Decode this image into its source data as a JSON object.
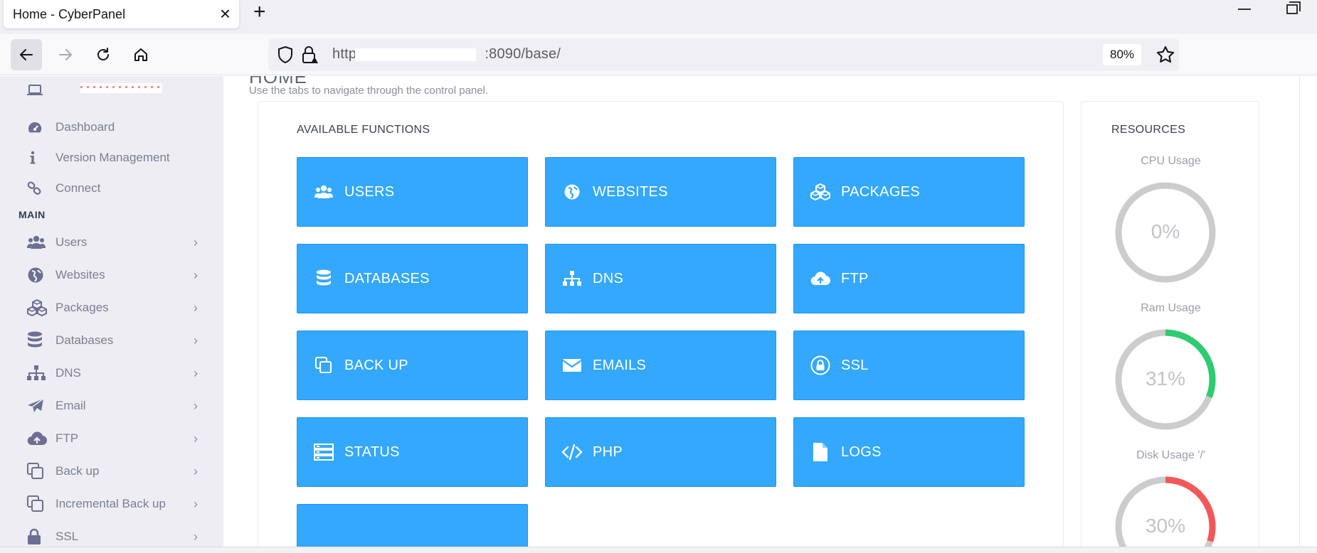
{
  "browser": {
    "tab_title": "Home - CyberPanel",
    "url_prefix": "https",
    "url_suffix": ":8090/base/",
    "zoom": "80%"
  },
  "sidebar": {
    "section_main": "MAIN",
    "top_items": [
      {
        "label": "Dashboard",
        "icon": "dashboard-icon"
      },
      {
        "label": "Version Management",
        "icon": "info-icon"
      },
      {
        "label": "Connect",
        "icon": "link-icon"
      }
    ],
    "main_items": [
      {
        "label": "Users",
        "icon": "users-icon"
      },
      {
        "label": "Websites",
        "icon": "globe-icon"
      },
      {
        "label": "Packages",
        "icon": "cubes-icon"
      },
      {
        "label": "Databases",
        "icon": "database-icon"
      },
      {
        "label": "DNS",
        "icon": "sitemap-icon"
      },
      {
        "label": "Email",
        "icon": "paper-plane-icon"
      },
      {
        "label": "FTP",
        "icon": "cloud-upload-icon"
      },
      {
        "label": "Back up",
        "icon": "clone-icon"
      },
      {
        "label": "Incremental Back up",
        "icon": "clone-icon"
      },
      {
        "label": "SSL",
        "icon": "lock-icon"
      }
    ]
  },
  "header": {
    "title": "HOME",
    "subtitle": "Use the tabs to navigate through the control panel."
  },
  "functions": {
    "title": "AVAILABLE FUNCTIONS",
    "tiles": [
      {
        "label": "USERS",
        "icon": "users-icon"
      },
      {
        "label": "WEBSITES",
        "icon": "globe-icon"
      },
      {
        "label": "PACKAGES",
        "icon": "cubes-icon"
      },
      {
        "label": "DATABASES",
        "icon": "database-icon"
      },
      {
        "label": "DNS",
        "icon": "sitemap-icon"
      },
      {
        "label": "FTP",
        "icon": "cloud-upload-icon"
      },
      {
        "label": "BACK UP",
        "icon": "clone-icon"
      },
      {
        "label": "EMAILS",
        "icon": "envelope-icon"
      },
      {
        "label": "SSL",
        "icon": "lock-icon"
      },
      {
        "label": "STATUS",
        "icon": "server-icon"
      },
      {
        "label": "PHP",
        "icon": "code-icon"
      },
      {
        "label": "LOGS",
        "icon": "file-icon"
      }
    ]
  },
  "resources": {
    "title": "RESOURCES",
    "gauges": [
      {
        "label": "CPU Usage",
        "value": "0%",
        "fraction": 0,
        "color": "#cccccc"
      },
      {
        "label": "Ram Usage",
        "value": "31%",
        "fraction": 0.31,
        "color": "#2ecc71"
      },
      {
        "label": "Disk Usage '/'",
        "value": "30%",
        "fraction": 0.3,
        "color": "#f25858"
      }
    ]
  },
  "colors": {
    "tile_bg": "#33a8fd",
    "sidebar_bg": "#ededf3",
    "gauge_track": "#cccccc"
  }
}
